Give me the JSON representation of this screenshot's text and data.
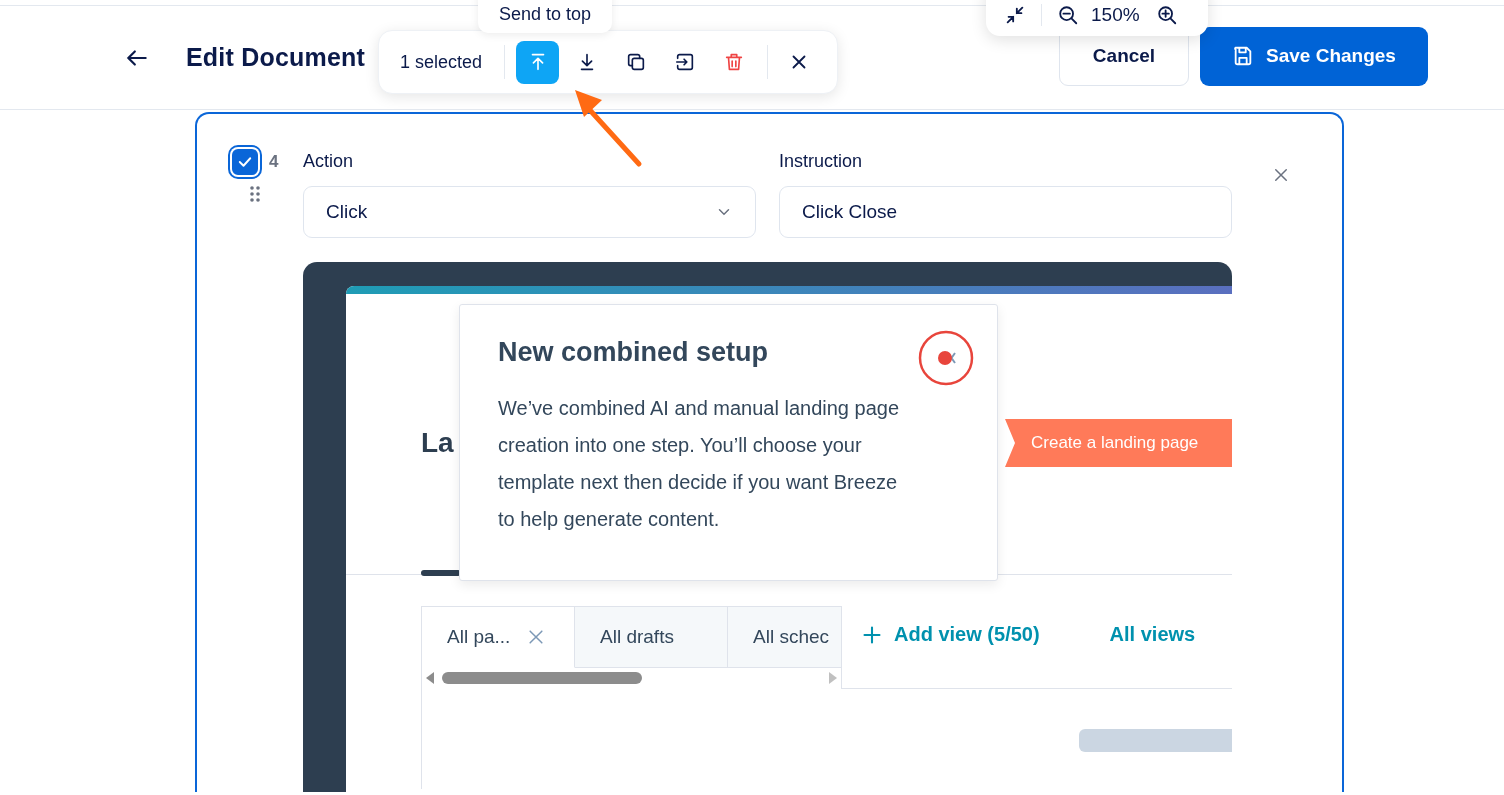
{
  "header": {
    "title": "Edit Document",
    "cancel": "Cancel",
    "save": "Save Changes"
  },
  "zoom_control": {
    "value": "150%"
  },
  "selection_toolbar": {
    "count": "1 selected",
    "tooltip": "Send to top",
    "actions": [
      {
        "kind": "send-top",
        "selected": true
      },
      {
        "kind": "send-bottom",
        "selected": false
      },
      {
        "kind": "duplicate",
        "selected": false
      },
      {
        "kind": "move",
        "selected": false
      },
      {
        "kind": "delete",
        "selected": false
      }
    ]
  },
  "step": {
    "checked": true,
    "number": "4",
    "action_label": "Action",
    "action_value": "Click",
    "instruction_label": "Instruction",
    "instruction_value": "Click Close"
  },
  "screenshot": {
    "heading": "La",
    "popover": {
      "title": "New combined setup",
      "body": "We’ve combined AI and manual landing page creation into one step. You’ll choose your template next then decide if you want Breeze to help generate content."
    },
    "callout": "Create a landing page",
    "tabs": [
      {
        "label": "All pa...",
        "selected": true,
        "closable": true
      },
      {
        "label": "All drafts",
        "selected": false,
        "closable": false
      },
      {
        "label": "All schec",
        "selected": false,
        "closable": false
      }
    ],
    "add_view": "Add view (5/50)",
    "all_views": "All views"
  }
}
